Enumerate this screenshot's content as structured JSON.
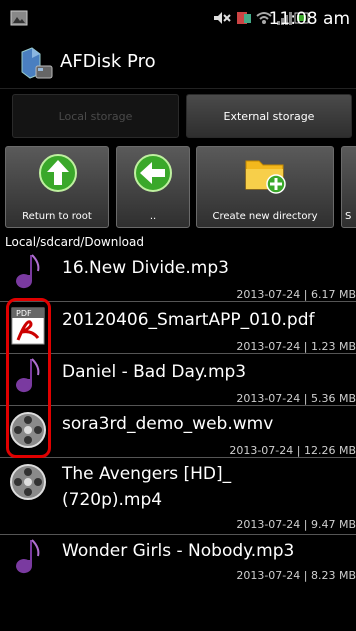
{
  "status": {
    "time": "11:08 am"
  },
  "app": {
    "title": "AFDisk Pro"
  },
  "tabs": {
    "local": "Local storage",
    "external": "External storage"
  },
  "toolbar": {
    "return_root": "Return to root",
    "up": "..",
    "new_dir": "Create new directory",
    "partial": "S"
  },
  "path": "Local/sdcard/Download",
  "files": [
    {
      "name": "16.New Divide.mp3",
      "meta": "2013-07-24 | 6.17 MB",
      "icon": "music-note-icon"
    },
    {
      "name": "20120406_SmartAPP_010.pdf",
      "meta": "2013-07-24 | 1.23 MB",
      "icon": "pdf-icon"
    },
    {
      "name": "Daniel - Bad Day.mp3",
      "meta": "2013-07-24 | 5.36 MB",
      "icon": "music-note-icon"
    },
    {
      "name": "sora3rd_demo_web.wmv",
      "meta": "2013-07-24 | 12.26 MB",
      "icon": "film-reel-icon"
    },
    {
      "name_line1": "The Avengers [HD]_",
      "name_line2": "(720p).mp4",
      "meta": "2013-07-24 | 9.47 MB",
      "icon": "film-reel-icon"
    },
    {
      "name": "Wonder Girls - Nobody.mp3",
      "meta": "2013-07-24 | 8.23 MB",
      "icon": "music-note-icon"
    }
  ],
  "colors": {
    "highlight": "#e00000",
    "accent_green": "#3aa82a",
    "folder": "#f3b81d"
  }
}
